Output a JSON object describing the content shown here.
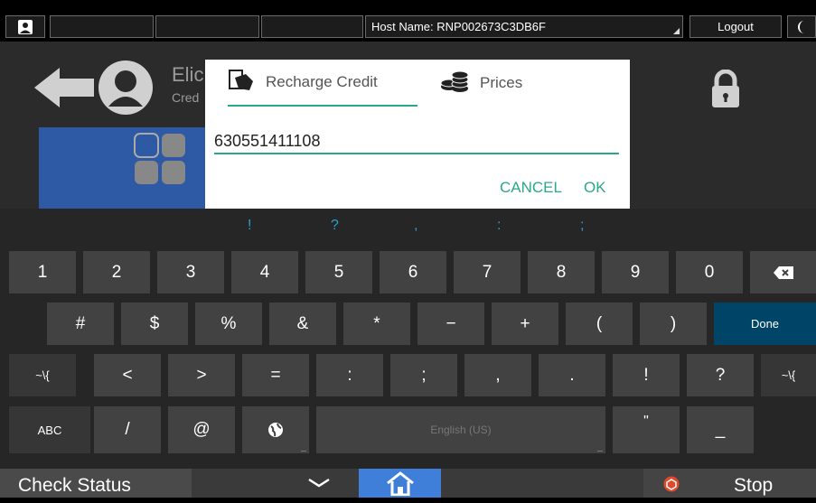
{
  "topbar": {
    "host_label": "Host Name: RNP002673C3DB6F",
    "logout_label": "Logout"
  },
  "background": {
    "user_name": "Elic",
    "user_sub": "Cred"
  },
  "dialog": {
    "tabs": [
      {
        "label": "Recharge Credit",
        "icon": "hand-card-icon"
      },
      {
        "label": "Prices",
        "icon": "coins-icon"
      }
    ],
    "input_value": "630551411108",
    "cancel_label": "CANCEL",
    "ok_label": "OK"
  },
  "keyboard": {
    "suggestions": [
      "!",
      "?",
      ",",
      ":",
      ";"
    ],
    "row1": [
      "1",
      "2",
      "3",
      "4",
      "5",
      "6",
      "7",
      "8",
      "9",
      "0"
    ],
    "row2": [
      "#",
      "$",
      "%",
      "&",
      "*",
      "−",
      "+",
      "(",
      ")"
    ],
    "done_label": "Done",
    "row3_left": "~\\{",
    "row3": [
      "<",
      ">",
      "=",
      ":",
      ";",
      ",",
      ".",
      "!",
      "?"
    ],
    "row3_right": "~\\{",
    "row4_abc": "ABC",
    "row4_slash": "/",
    "row4_at": "@",
    "space_label": "English (US)",
    "row4_quote": "\"",
    "row4_underscore": "_"
  },
  "bottombar": {
    "check_status_label": "Check Status",
    "stop_label": "Stop"
  },
  "colors": {
    "accent": "#2aa88c",
    "done_key": "#004467",
    "home_button": "#3f7fd9",
    "tile": "#2d59a5"
  }
}
